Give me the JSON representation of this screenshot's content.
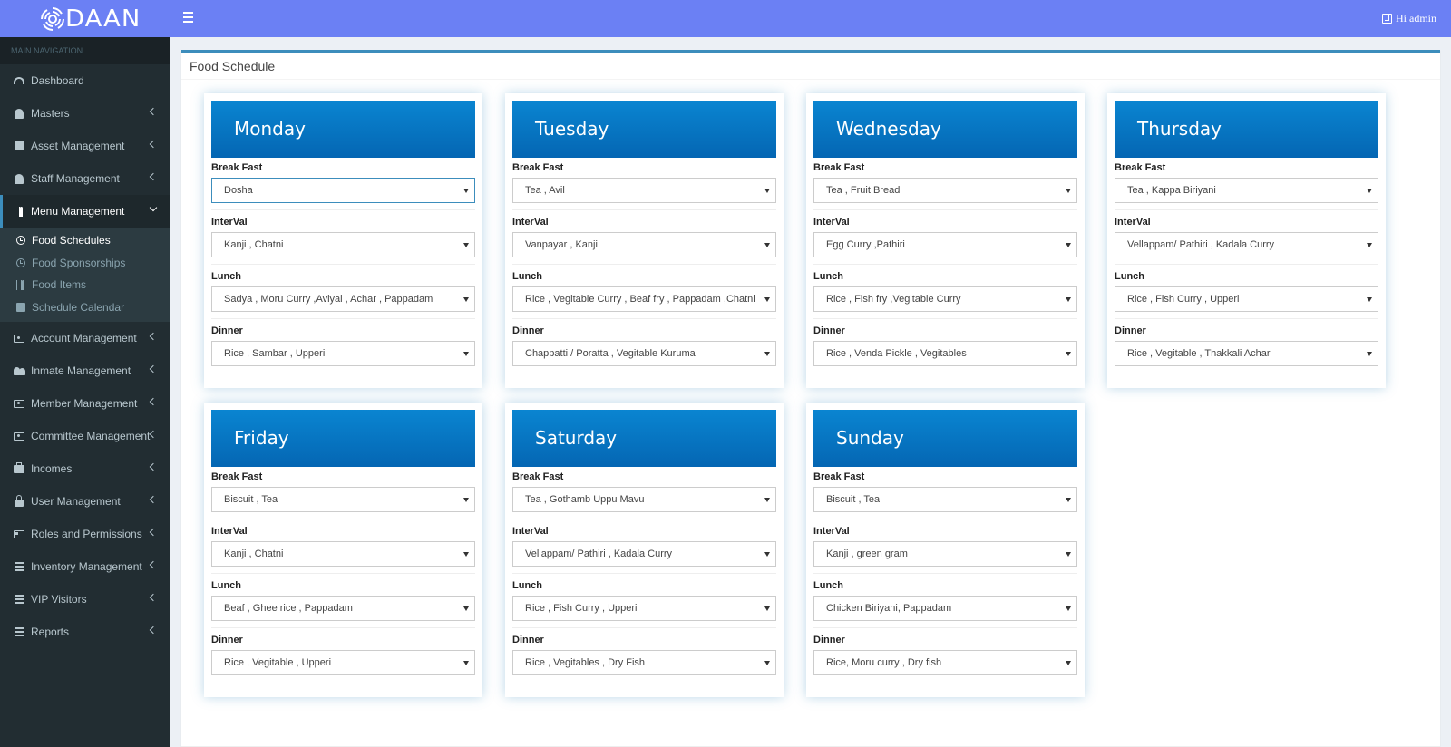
{
  "header": {
    "brand": "DAAN",
    "user_label": "Hi admin"
  },
  "sidebar": {
    "section_title": "MAIN NAVIGATION",
    "items": [
      {
        "label": "Dashboard",
        "icon": "dashboard-icon"
      },
      {
        "label": "Masters",
        "icon": "address-book-icon"
      },
      {
        "label": "Asset Management",
        "icon": "building-icon"
      },
      {
        "label": "Staff Management",
        "icon": "user-icon"
      },
      {
        "label": "Menu Management",
        "icon": "cutlery-icon"
      },
      {
        "label": "Account Management",
        "icon": "money-icon"
      },
      {
        "label": "Inmate Management",
        "icon": "users-icon"
      },
      {
        "label": "Member Management",
        "icon": "money-icon"
      },
      {
        "label": "Committee Management",
        "icon": "money-icon"
      },
      {
        "label": "Incomes",
        "icon": "briefcase-icon"
      },
      {
        "label": "User Management",
        "icon": "lock-icon"
      },
      {
        "label": "Roles and Permissions",
        "icon": "id-card-icon"
      },
      {
        "label": "Inventory Management",
        "icon": "list-icon"
      },
      {
        "label": "VIP Visitors",
        "icon": "list-icon"
      },
      {
        "label": "Reports",
        "icon": "list-icon"
      }
    ],
    "submenu": [
      {
        "label": "Food Schedules",
        "icon": "clock-icon"
      },
      {
        "label": "Food Sponsorships",
        "icon": "clock-icon"
      },
      {
        "label": "Food Items",
        "icon": "cutlery-icon"
      },
      {
        "label": "Schedule Calendar",
        "icon": "calendar-icon"
      }
    ]
  },
  "page": {
    "title": "Food Schedule"
  },
  "meal_labels": {
    "breakfast": "Break Fast",
    "interval": "InterVal",
    "lunch": "Lunch",
    "dinner": "Dinner"
  },
  "days": [
    {
      "name": "Monday",
      "breakfast": "Dosha",
      "interval": "Kanji , Chatni",
      "lunch": "Sadya , Moru Curry ,Aviyal , Achar , Pappadam",
      "dinner": "Rice , Sambar , Upperi"
    },
    {
      "name": "Tuesday",
      "breakfast": "Tea , Avil",
      "interval": "Vanpayar , Kanji",
      "lunch": "Rice , Vegitable Curry , Beaf fry , Pappadam ,Chatni",
      "dinner": "Chappatti / Poratta , Vegitable Kuruma"
    },
    {
      "name": "Wednesday",
      "breakfast": "Tea , Fruit Bread",
      "interval": "Egg Curry ,Pathiri",
      "lunch": "Rice , Fish fry ,Vegitable Curry",
      "dinner": "Rice , Venda Pickle , Vegitables"
    },
    {
      "name": "Thursday",
      "breakfast": "Tea , Kappa Biriyani",
      "interval": "Vellappam/ Pathiri , Kadala Curry",
      "lunch": "Rice , Fish Curry , Upperi",
      "dinner": "Rice , Vegitable , Thakkali Achar"
    },
    {
      "name": "Friday",
      "breakfast": "Biscuit , Tea",
      "interval": "Kanji , Chatni",
      "lunch": "Beaf , Ghee rice , Pappadam",
      "dinner": "Rice , Vegitable , Upperi"
    },
    {
      "name": "Saturday",
      "breakfast": "Tea , Gothamb Uppu Mavu",
      "interval": "Vellappam/ Pathiri , Kadala Curry",
      "lunch": "Rice , Fish Curry , Upperi",
      "dinner": "Rice , Vegitables , Dry Fish"
    },
    {
      "name": "Sunday",
      "breakfast": "Biscuit , Tea",
      "interval": "Kanji , green gram",
      "lunch": "Chicken Biriyani, Pappadam",
      "dinner": "Rice, Moru curry , Dry fish"
    }
  ],
  "colors": {
    "header_bg": "#6b80f4",
    "sidebar_bg": "#222d32",
    "accent": "#3c8dbc",
    "day_header": "#0466b3"
  }
}
